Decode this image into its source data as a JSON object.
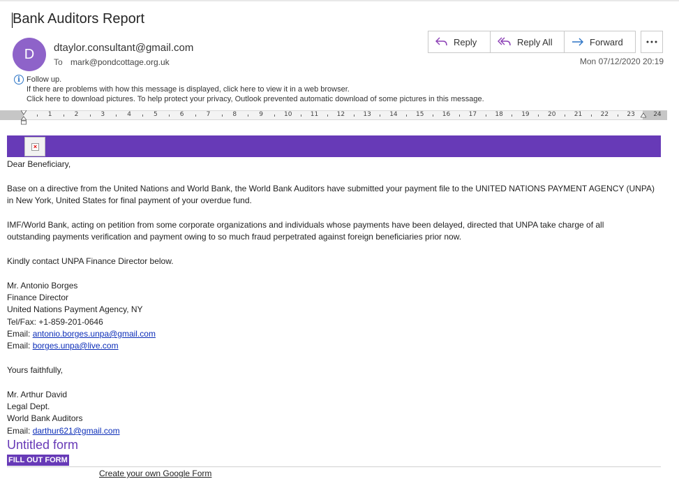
{
  "message": {
    "subject": "Bank Auditors Report",
    "avatar_initial": "D",
    "sender": "dtaylor.consultant@gmail.com",
    "to_label": "To",
    "to": "mark@pondcottage.org.uk",
    "date": "Mon 07/12/2020 20:19"
  },
  "actions": {
    "reply": "Reply",
    "reply_all": "Reply All",
    "forward": "Forward",
    "more": "..."
  },
  "info_bar": {
    "icon": "i",
    "line1": "Follow up.",
    "line2": "If there are problems with how this message is displayed, click here to view it in a web browser.",
    "line3": "Click here to download pictures. To help protect your privacy, Outlook prevented automatic download of some pictures in this message."
  },
  "ruler": {
    "numbers": [
      "1",
      "2",
      "3",
      "4",
      "5",
      "6",
      "7",
      "8",
      "9",
      "10",
      "11",
      "12",
      "13",
      "14",
      "15",
      "16",
      "17",
      "18",
      "19",
      "20",
      "21",
      "22",
      "23",
      "24"
    ]
  },
  "body": {
    "greeting": "Dear Beneficiary,",
    "p1_l1": "Base on a directive from the United Nations and World Bank, the World Bank Auditors have submitted your payment file to the UNITED NATIONS PAYMENT AGENCY (UNPA)",
    "p1_l2": "in New York, United States for final payment of your overdue fund.",
    "p2_l1": "IMF/World Bank, acting on petition from some corporate organizations and individuals whose payments have been delayed, directed that UNPA take charge of all",
    "p2_l2": "outstanding payments verification and payment owing to so much fraud perpetrated against foreign beneficiaries prior now.",
    "p3": "Kindly contact UNPA Finance Director below.",
    "contact1_name": "Mr. Antonio Borges",
    "contact1_title": "Finance Director",
    "contact1_org": "United Nations Payment Agency, NY",
    "contact1_tel": "Tel/Fax: +1-859-201-0646",
    "email_label": "Email:",
    "contact1_email1": "antonio.borges.unpa@gmail.com",
    "contact1_email2": "borges.unpa@live.com",
    "closing": "Yours faithfully,",
    "contact2_name": "Mr. Arthur David",
    "contact2_title": "Legal Dept.",
    "contact2_org": "World Bank Auditors",
    "contact2_email": "darthur621@gmail.com"
  },
  "form": {
    "title": "Untitled form",
    "button": "FILL OUT FORM",
    "create_link": "Create your own Google Form"
  },
  "colors": {
    "brand_purple": "#673ab7",
    "avatar": "#8e63c9",
    "link": "#0b2db8",
    "accent_icon": "#8b3fb5"
  }
}
